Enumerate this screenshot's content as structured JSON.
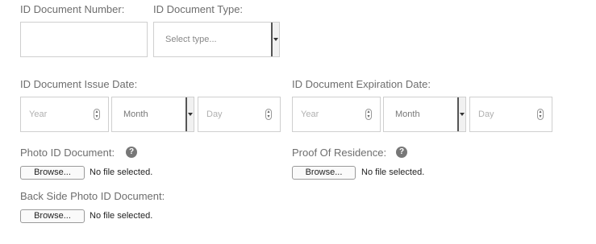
{
  "id_number": {
    "label": "ID Document Number:",
    "value": ""
  },
  "id_type": {
    "label": "ID Document Type:",
    "placeholder": "Select type..."
  },
  "issue_date": {
    "label": "ID Document Issue Date:",
    "year_placeholder": "Year",
    "month_value": "Month",
    "day_placeholder": "Day"
  },
  "expiration_date": {
    "label": "ID Document Expiration Date:",
    "year_placeholder": "Year",
    "month_value": "Month",
    "day_placeholder": "Day"
  },
  "photo_id": {
    "label": "Photo ID Document:",
    "help": "?",
    "browse": "Browse...",
    "status": "No file selected."
  },
  "proof_residence": {
    "label": "Proof Of Residence:",
    "help": "?",
    "browse": "Browse...",
    "status": "No file selected."
  },
  "back_side": {
    "label": "Back Side Photo ID Document:",
    "browse": "Browse...",
    "status": "No file selected."
  },
  "icons": {
    "spinner": "spinner-arrows-icon",
    "dropdown": "dropdown-arrow-icon",
    "help": "question-circle-icon"
  }
}
